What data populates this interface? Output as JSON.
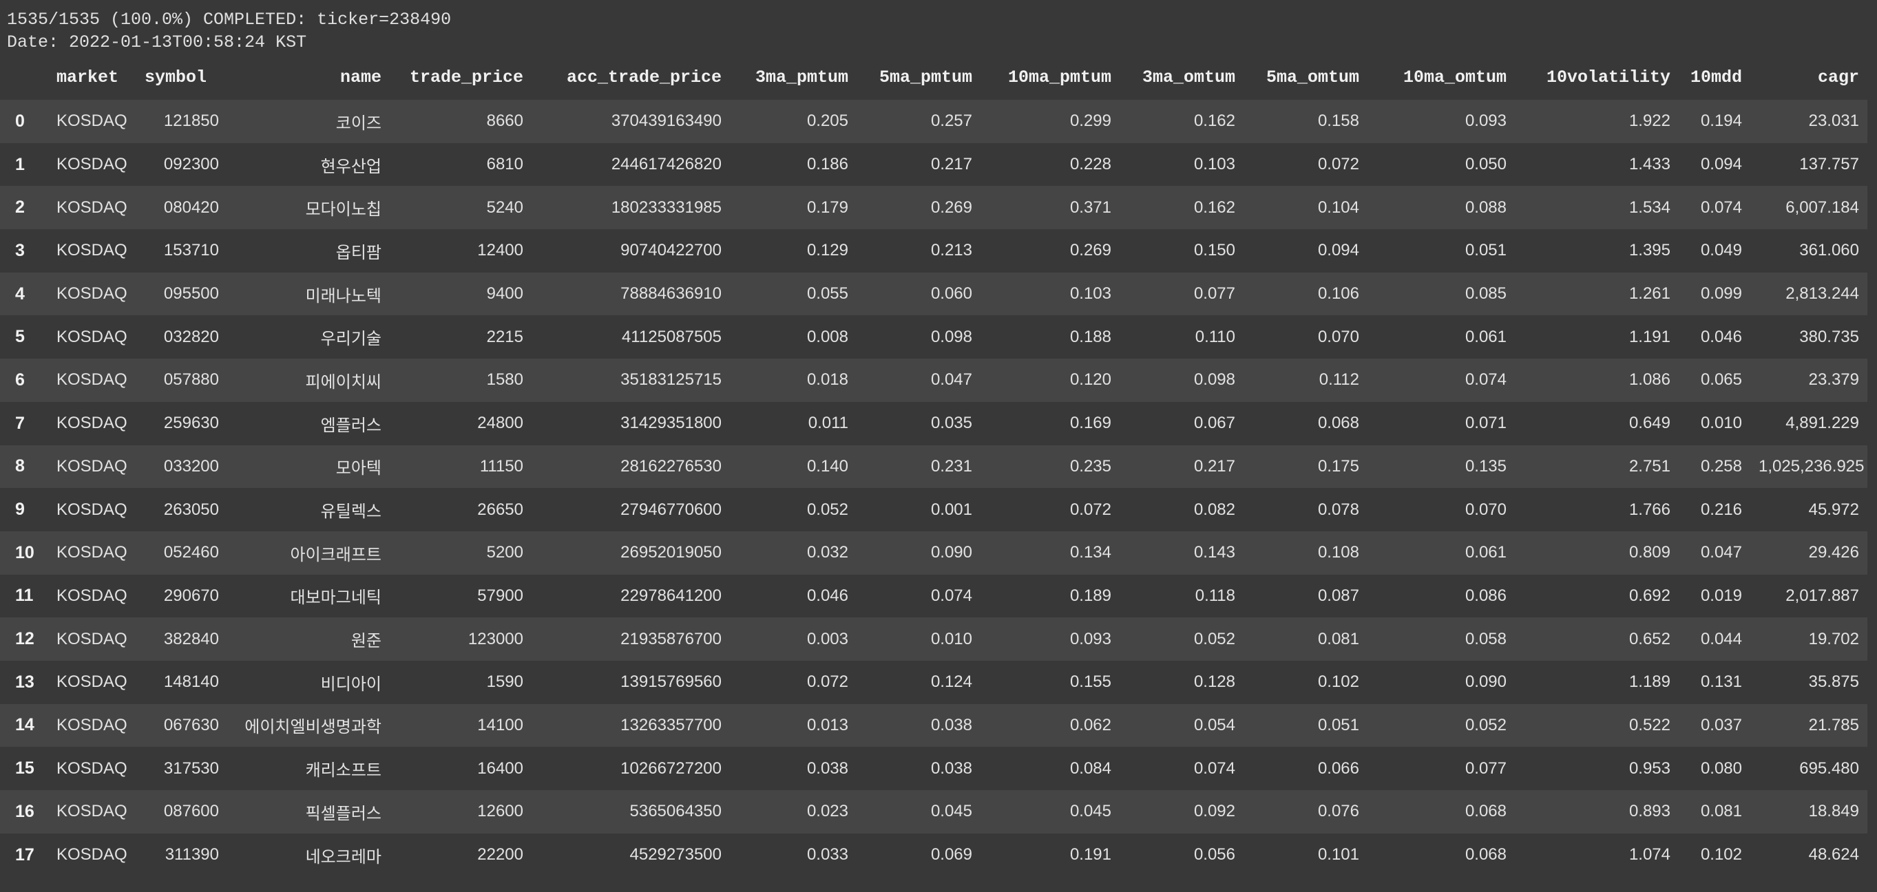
{
  "output": {
    "status_line": "1535/1535 (100.0%) COMPLETED: ticker=238490",
    "date_line": "Date: 2022-01-13T00:58:24 KST"
  },
  "table": {
    "columns": [
      "",
      "market",
      "symbol",
      "name",
      "trade_price",
      "acc_trade_price",
      "3ma_pmtum",
      "5ma_pmtum",
      "10ma_pmtum",
      "3ma_omtum",
      "5ma_omtum",
      "10ma_omtum",
      "10volatility",
      "10mdd",
      "cagr"
    ],
    "rows": [
      [
        "0",
        "KOSDAQ",
        "121850",
        "코이즈",
        "8660",
        "370439163490",
        "0.205",
        "0.257",
        "0.299",
        "0.162",
        "0.158",
        "0.093",
        "1.922",
        "0.194",
        "23.031"
      ],
      [
        "1",
        "KOSDAQ",
        "092300",
        "현우산업",
        "6810",
        "244617426820",
        "0.186",
        "0.217",
        "0.228",
        "0.103",
        "0.072",
        "0.050",
        "1.433",
        "0.094",
        "137.757"
      ],
      [
        "2",
        "KOSDAQ",
        "080420",
        "모다이노칩",
        "5240",
        "180233331985",
        "0.179",
        "0.269",
        "0.371",
        "0.162",
        "0.104",
        "0.088",
        "1.534",
        "0.074",
        "6,007.184"
      ],
      [
        "3",
        "KOSDAQ",
        "153710",
        "옵티팜",
        "12400",
        "90740422700",
        "0.129",
        "0.213",
        "0.269",
        "0.150",
        "0.094",
        "0.051",
        "1.395",
        "0.049",
        "361.060"
      ],
      [
        "4",
        "KOSDAQ",
        "095500",
        "미래나노텍",
        "9400",
        "78884636910",
        "0.055",
        "0.060",
        "0.103",
        "0.077",
        "0.106",
        "0.085",
        "1.261",
        "0.099",
        "2,813.244"
      ],
      [
        "5",
        "KOSDAQ",
        "032820",
        "우리기술",
        "2215",
        "41125087505",
        "0.008",
        "0.098",
        "0.188",
        "0.110",
        "0.070",
        "0.061",
        "1.191",
        "0.046",
        "380.735"
      ],
      [
        "6",
        "KOSDAQ",
        "057880",
        "피에이치씨",
        "1580",
        "35183125715",
        "0.018",
        "0.047",
        "0.120",
        "0.098",
        "0.112",
        "0.074",
        "1.086",
        "0.065",
        "23.379"
      ],
      [
        "7",
        "KOSDAQ",
        "259630",
        "엠플러스",
        "24800",
        "31429351800",
        "0.011",
        "0.035",
        "0.169",
        "0.067",
        "0.068",
        "0.071",
        "0.649",
        "0.010",
        "4,891.229"
      ],
      [
        "8",
        "KOSDAQ",
        "033200",
        "모아텍",
        "11150",
        "28162276530",
        "0.140",
        "0.231",
        "0.235",
        "0.217",
        "0.175",
        "0.135",
        "2.751",
        "0.258",
        "1,025,236.925"
      ],
      [
        "9",
        "KOSDAQ",
        "263050",
        "유틸렉스",
        "26650",
        "27946770600",
        "0.052",
        "0.001",
        "0.072",
        "0.082",
        "0.078",
        "0.070",
        "1.766",
        "0.216",
        "45.972"
      ],
      [
        "10",
        "KOSDAQ",
        "052460",
        "아이크래프트",
        "5200",
        "26952019050",
        "0.032",
        "0.090",
        "0.134",
        "0.143",
        "0.108",
        "0.061",
        "0.809",
        "0.047",
        "29.426"
      ],
      [
        "11",
        "KOSDAQ",
        "290670",
        "대보마그네틱",
        "57900",
        "22978641200",
        "0.046",
        "0.074",
        "0.189",
        "0.118",
        "0.087",
        "0.086",
        "0.692",
        "0.019",
        "2,017.887"
      ],
      [
        "12",
        "KOSDAQ",
        "382840",
        "원준",
        "123000",
        "21935876700",
        "0.003",
        "0.010",
        "0.093",
        "0.052",
        "0.081",
        "0.058",
        "0.652",
        "0.044",
        "19.702"
      ],
      [
        "13",
        "KOSDAQ",
        "148140",
        "비디아이",
        "1590",
        "13915769560",
        "0.072",
        "0.124",
        "0.155",
        "0.128",
        "0.102",
        "0.090",
        "1.189",
        "0.131",
        "35.875"
      ],
      [
        "14",
        "KOSDAQ",
        "067630",
        "에이치엘비생명과학",
        "14100",
        "13263357700",
        "0.013",
        "0.038",
        "0.062",
        "0.054",
        "0.051",
        "0.052",
        "0.522",
        "0.037",
        "21.785"
      ],
      [
        "15",
        "KOSDAQ",
        "317530",
        "캐리소프트",
        "16400",
        "10266727200",
        "0.038",
        "0.038",
        "0.084",
        "0.074",
        "0.066",
        "0.077",
        "0.953",
        "0.080",
        "695.480"
      ],
      [
        "16",
        "KOSDAQ",
        "087600",
        "픽셀플러스",
        "12600",
        "5365064350",
        "0.023",
        "0.045",
        "0.045",
        "0.092",
        "0.076",
        "0.068",
        "0.893",
        "0.081",
        "18.849"
      ],
      [
        "17",
        "KOSDAQ",
        "311390",
        "네오크레마",
        "22200",
        "4529273500",
        "0.033",
        "0.069",
        "0.191",
        "0.056",
        "0.101",
        "0.068",
        "1.074",
        "0.102",
        "48.624"
      ]
    ]
  }
}
